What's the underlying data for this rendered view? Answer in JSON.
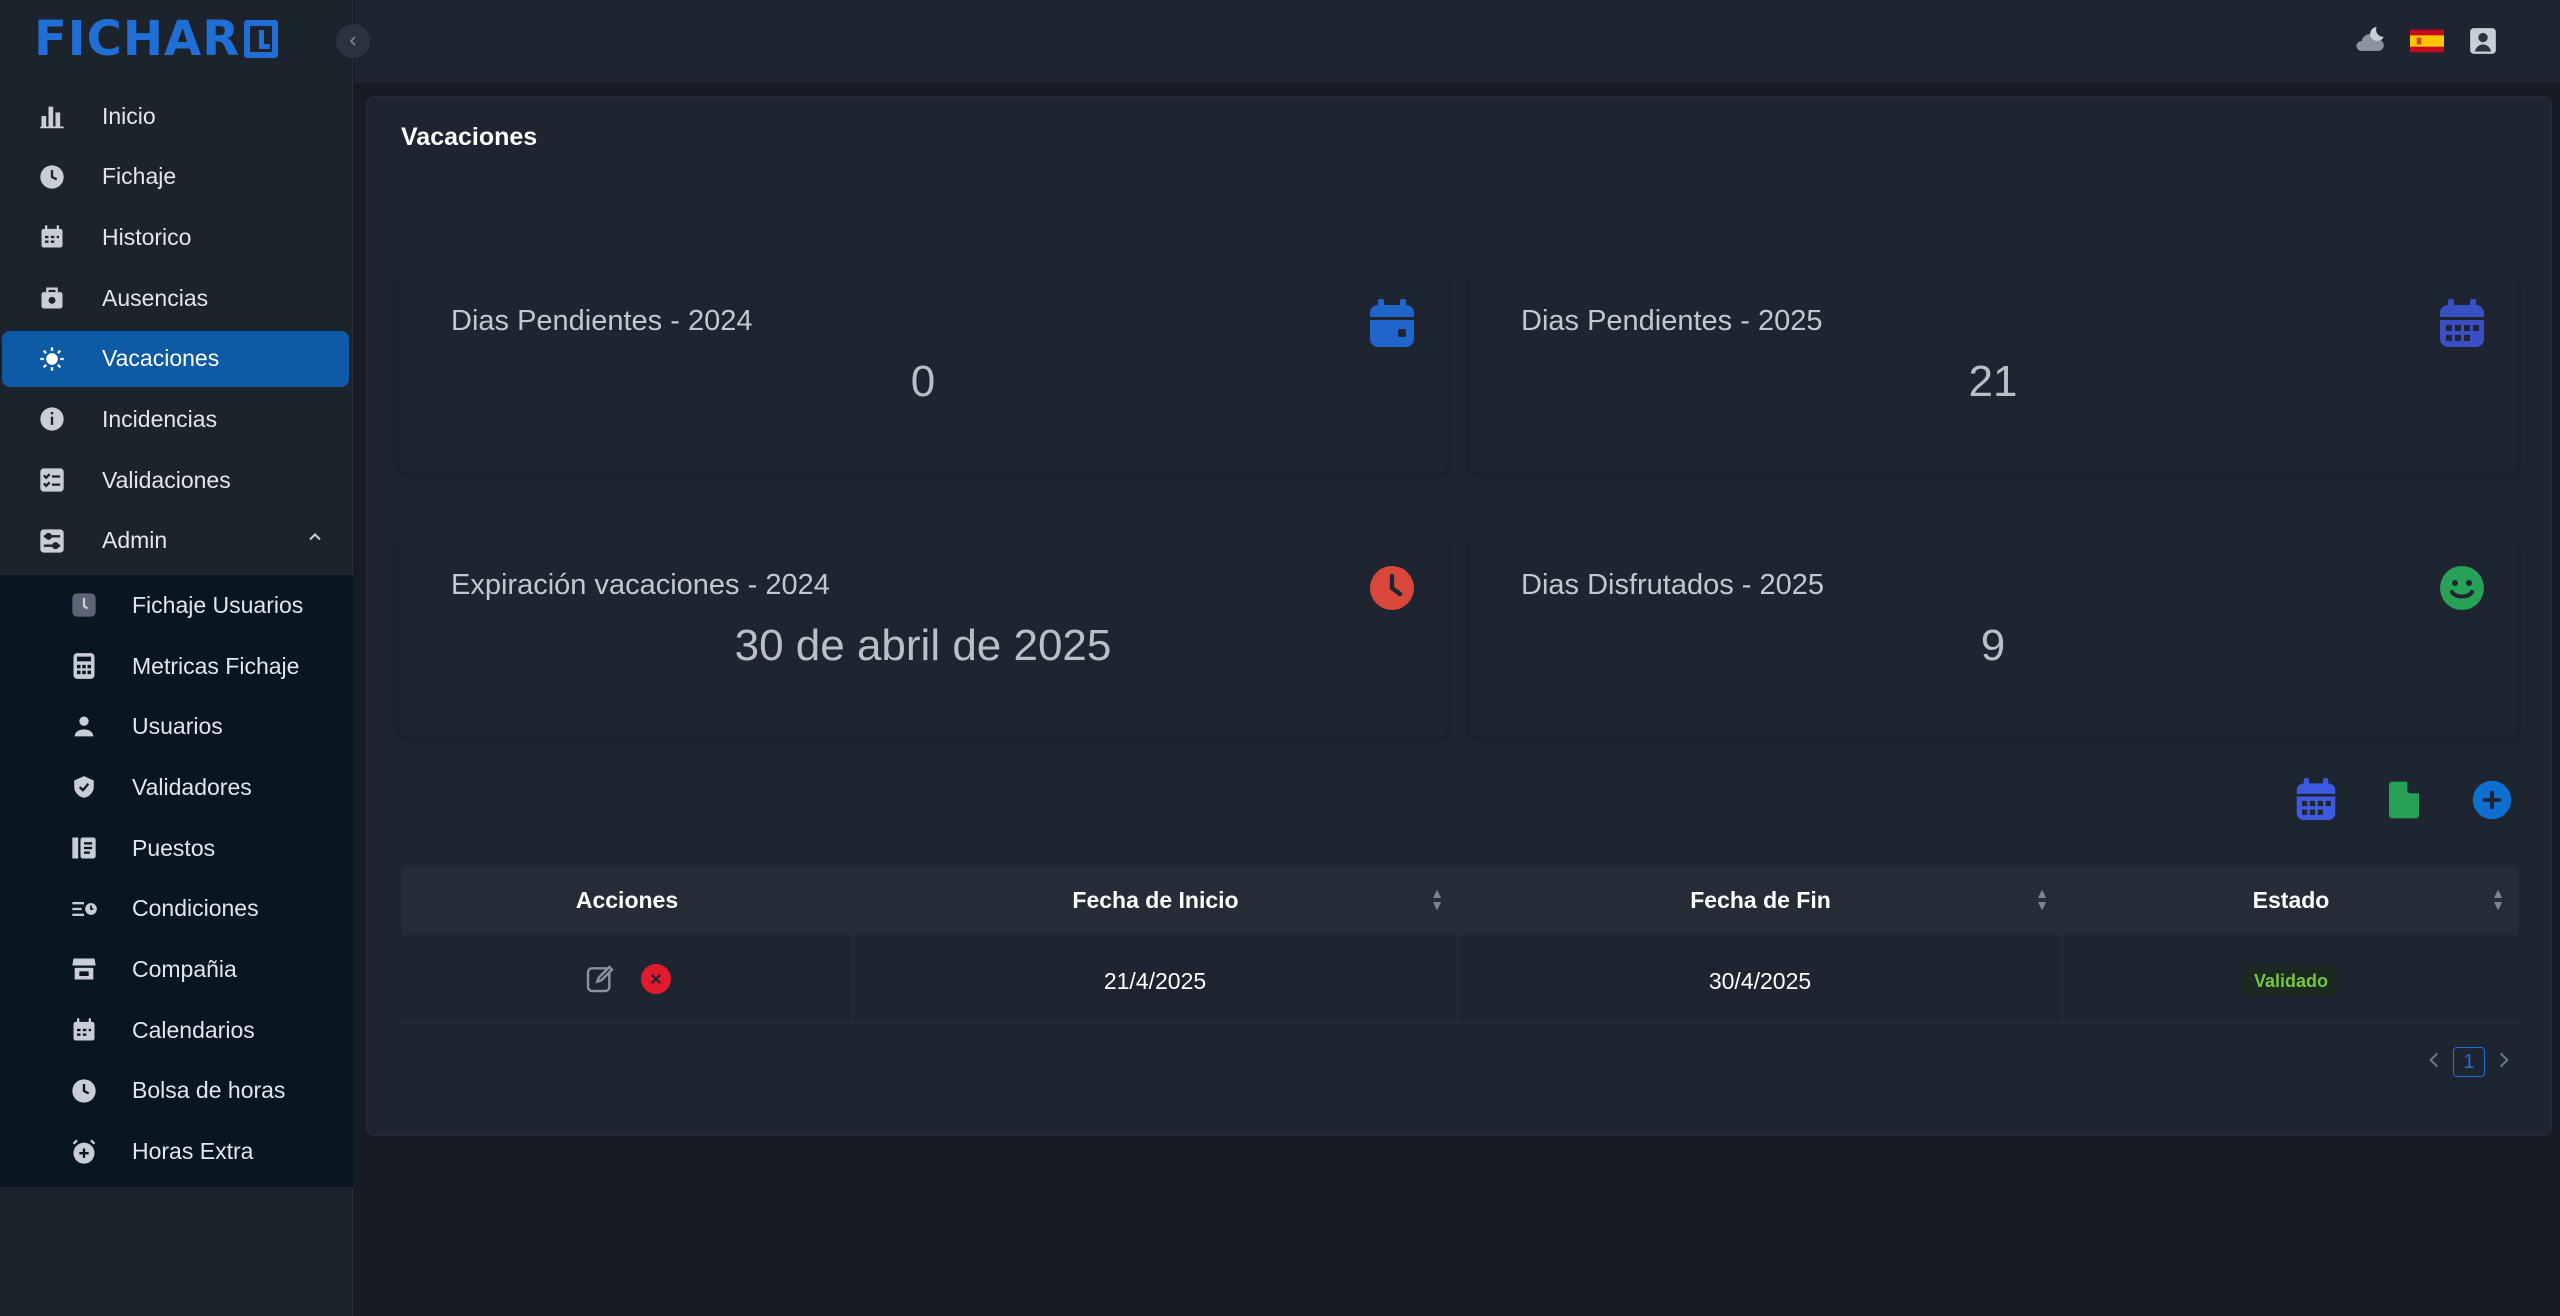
{
  "app": {
    "logo_text": "FICHAR"
  },
  "sidebar": {
    "items": [
      {
        "label": "Inicio",
        "icon": "bar-chart-icon"
      },
      {
        "label": "Fichaje",
        "icon": "clock-icon"
      },
      {
        "label": "Historico",
        "icon": "calendar-icon"
      },
      {
        "label": "Ausencias",
        "icon": "briefcase-icon"
      },
      {
        "label": "Vacaciones",
        "icon": "sun-icon",
        "active": true
      },
      {
        "label": "Incidencias",
        "icon": "info-icon"
      },
      {
        "label": "Validaciones",
        "icon": "checklist-icon"
      },
      {
        "label": "Admin",
        "icon": "settings-panel-icon",
        "expanded": true
      }
    ],
    "admin_items": [
      {
        "label": "Fichaje Usuarios",
        "icon": "user-clock-icon"
      },
      {
        "label": "Metricas Fichaje",
        "icon": "calculator-icon"
      },
      {
        "label": "Usuarios",
        "icon": "users-icon"
      },
      {
        "label": "Validadores",
        "icon": "shield-check-icon"
      },
      {
        "label": "Puestos",
        "icon": "id-card-icon"
      },
      {
        "label": "Condiciones",
        "icon": "list-clock-icon"
      },
      {
        "label": "Compañia",
        "icon": "store-icon"
      },
      {
        "label": "Calendarios",
        "icon": "calendar-icon"
      },
      {
        "label": "Bolsa de horas",
        "icon": "clock-icon"
      },
      {
        "label": "Horas Extra",
        "icon": "alarm-plus-icon"
      }
    ]
  },
  "topbar": {
    "icons": [
      "theme-moon-icon",
      "spain-flag-icon",
      "user-avatar-icon"
    ]
  },
  "page": {
    "title": "Vacaciones"
  },
  "stats": [
    {
      "label": "Dias Pendientes - 2024",
      "value": "0",
      "icon": "calendar-event-icon",
      "color": "#2065c9"
    },
    {
      "label": "Dias Pendientes - 2025",
      "value": "21",
      "icon": "calendar-grid-icon",
      "color": "#3b4fc4"
    },
    {
      "label": "Expiración vacaciones - 2024",
      "value": "30 de abril de 2025",
      "icon": "clock-icon",
      "color": "#d9473a"
    },
    {
      "label": "Dias Disfrutados - 2025",
      "value": "9",
      "icon": "smile-icon",
      "color": "#27a155"
    }
  ],
  "toolbar": {
    "icons": [
      "calendar-view-icon",
      "export-sheet-icon",
      "add-icon"
    ]
  },
  "table": {
    "headers": [
      "Acciones",
      "Fecha de Inicio",
      "Fecha de Fin",
      "Estado"
    ],
    "rows": [
      {
        "inicio": "21/4/2025",
        "fin": "30/4/2025",
        "estado": "Validado"
      }
    ]
  },
  "pagination": {
    "current": "1"
  }
}
